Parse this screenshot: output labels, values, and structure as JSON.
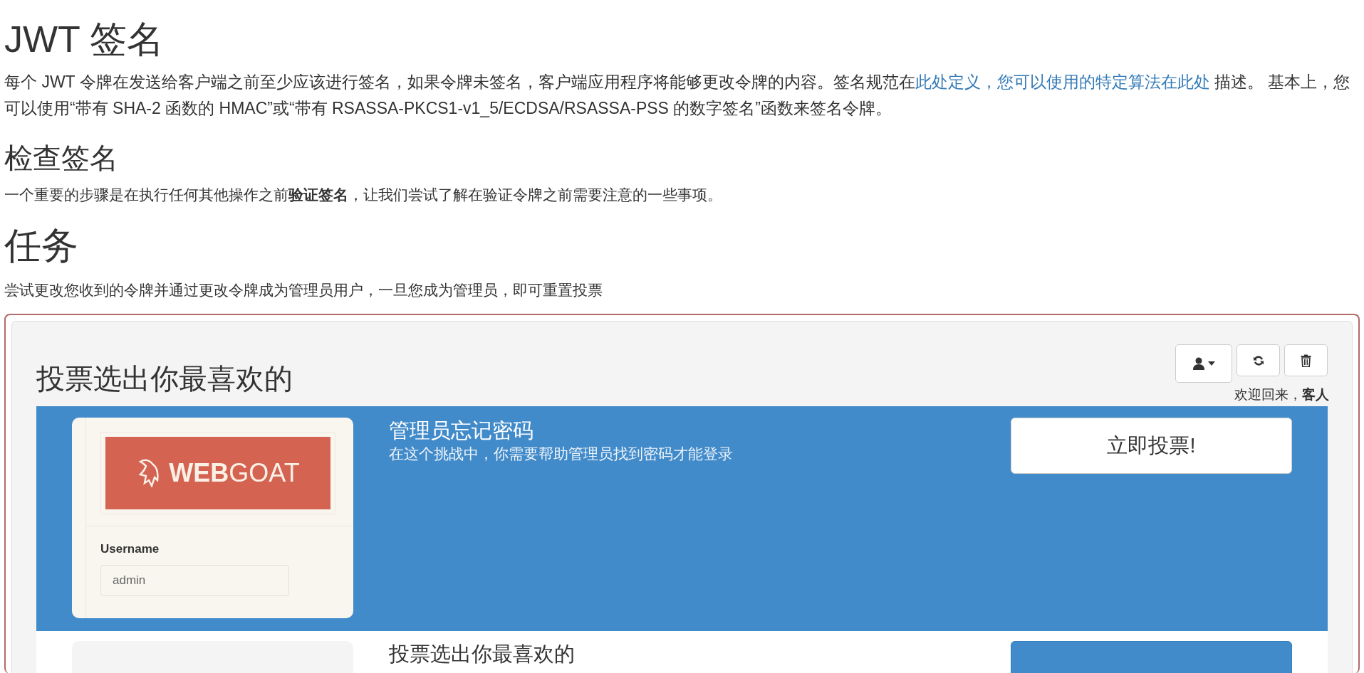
{
  "title": "JWT 签名",
  "intro": [
    {
      "kind": "text",
      "text": "每个 JWT 令牌在发送给客户端之前至少应该进行签名，如果令牌未签名，客户端应用程序将能够更改令牌的内容。签名规范在"
    },
    {
      "kind": "link",
      "text": "此处定义，您可以使用的特定算法在此处"
    },
    {
      "kind": "text",
      "text": " 描述。 基本上，您可以使用“带有 SHA-2 函数的 HMAC”或“带有 RSASSA-PKCS1-v1_5/ECDSA/RSASSA-PSS 的数字签名”函数来签名令牌。"
    }
  ],
  "check": {
    "heading": "检查签名",
    "text": "一个重要的步骤是在执行任何其他操作之前**验证签名**，让我们尝试了解在验证令牌之前需要注意的一些事项。"
  },
  "task": {
    "heading": "任务",
    "text": "尝试更改您收到的令牌并通过更改令牌成为管理员用户，一旦您成为管理员，即可重置投票"
  },
  "vote_panel": {
    "title": "投票选出你最喜欢的",
    "toolbar": [
      {
        "kind": "user-menu"
      },
      {
        "kind": "refresh"
      },
      {
        "kind": "delete"
      }
    ],
    "welcome": "欢迎回来，**客人**",
    "votes": [
      {
        "selected": true,
        "title": "管理员忘记密码",
        "description": "在这个挑战中，你需要帮助管理员找到密码才能登录",
        "button": "立即投票!",
        "image": {
          "kind": "login-screenshot",
          "logo_bold": "WEB",
          "logo_light": "GOAT",
          "username_label": "Username",
          "username_value": "admin"
        }
      },
      {
        "selected": false,
        "title": "投票选出你最喜欢的",
        "image": {
          "kind": "blank"
        }
      }
    ]
  }
}
